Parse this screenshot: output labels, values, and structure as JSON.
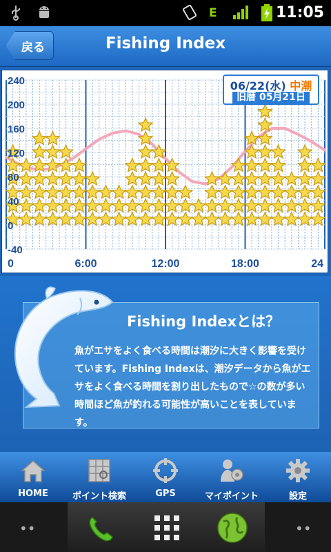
{
  "status_bar": {
    "time": "11:05",
    "icons": [
      "usb-icon",
      "android-icon",
      "vibrate-icon",
      "edge-signal-icon",
      "signal-bars-icon",
      "battery-charging-icon"
    ],
    "network_label": "E"
  },
  "header": {
    "back_label": "戻る",
    "title": "Fishing Index"
  },
  "date_box": {
    "date": "06/22(水)",
    "tide": "中潮",
    "lunar": "旧暦 05月21日"
  },
  "colors": {
    "accent": "#1e69c4",
    "tide_curve": "#f4a7b9",
    "star_fill": "#f6d94b",
    "grid": "#2c6fc0"
  },
  "chart_data": {
    "type": "bar",
    "ylim": [
      -40,
      240
    ],
    "y_ticks": [
      "240",
      "200",
      "160",
      "120",
      "80",
      "40",
      "0",
      "-40"
    ],
    "x_ticks": [
      "0",
      "6:00",
      "12:00",
      "18:00",
      "24"
    ],
    "xlim": [
      0,
      24
    ],
    "grid": true,
    "hours": [
      0.5,
      1.5,
      2.5,
      3.5,
      4.5,
      5.5,
      6.5,
      7.5,
      8.5,
      9.5,
      10.5,
      11.5,
      12.5,
      13.5,
      14.5,
      15.5,
      16.5,
      17.5,
      18.5,
      19.5,
      20.5,
      21.5,
      22.5,
      23.5
    ],
    "stars": [
      6,
      5,
      7,
      7,
      6,
      5,
      4,
      3,
      3,
      5,
      8,
      6,
      5,
      3,
      2,
      4,
      4,
      5,
      7,
      9,
      6,
      4,
      6,
      5
    ],
    "tide_curve": {
      "hours": [
        0,
        1,
        2,
        3,
        4,
        5,
        6,
        7,
        8,
        9,
        10,
        11,
        12,
        13,
        14,
        15,
        16,
        17,
        18,
        19,
        20,
        21,
        22,
        23,
        24
      ],
      "levels": [
        112,
        100,
        93,
        92,
        98,
        110,
        126,
        142,
        152,
        156,
        150,
        134,
        110,
        88,
        72,
        68,
        76,
        96,
        122,
        146,
        160,
        160,
        150,
        138,
        124
      ]
    }
  },
  "info": {
    "title": "Fishing Indexとは？",
    "body": "魚がエサをよく食べる時間は潮汐に大きく影響を受けています。Fishing Indexは、潮汐データから魚がエサをよく食べる時間を割り出したもので☆の数が多い時間ほど魚が釣れる可能性が高いことを表しています。"
  },
  "tabs": [
    {
      "label": "HOME",
      "icon": "home-icon"
    },
    {
      "label": "ポイント検索",
      "icon": "map-search-icon"
    },
    {
      "label": "GPS",
      "icon": "gps-crosshair-icon"
    },
    {
      "label": "マイポイント",
      "icon": "my-point-icon"
    },
    {
      "label": "設定",
      "icon": "gear-icon"
    }
  ],
  "nav": {
    "icons": [
      "phone-icon",
      "app-grid-icon",
      "globe-icon"
    ]
  }
}
